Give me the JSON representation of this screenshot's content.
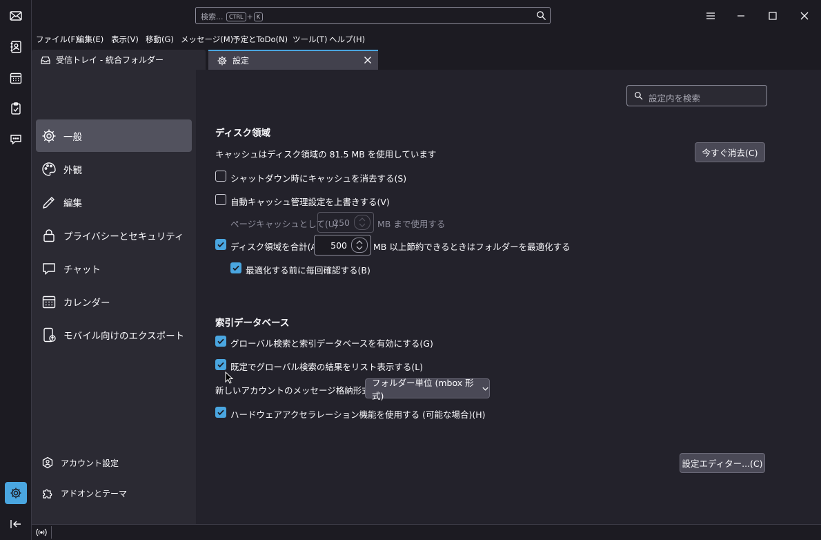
{
  "colors": {
    "accent": "#4aa6e0",
    "background": "#23222b",
    "nav": "#2b2a33",
    "selected": "#52525e"
  },
  "spaces": [
    {
      "icon": "mail-icon"
    },
    {
      "icon": "address-book-icon"
    },
    {
      "icon": "calendar-icon"
    },
    {
      "icon": "tasks-icon"
    },
    {
      "icon": "chat-icon"
    }
  ],
  "titlebar": {
    "search_placeholder": "検索...",
    "key_ctrl": "CTRL",
    "plus": "+",
    "key_k": "K"
  },
  "menubar": [
    "ファイル(F)",
    "編集(E)",
    "表示(V)",
    "移動(G)",
    "メッセージ(M)",
    "予定とToDo(N)",
    "ツール(T)",
    "ヘルプ(H)"
  ],
  "tabs": {
    "inbox": "受信トレイ - 統合フォルダー",
    "settings": "設定"
  },
  "nav": {
    "items": [
      "一般",
      "外観",
      "編集",
      "プライバシーとセキュリティ",
      "チャット",
      "カレンダー",
      "モバイル向けのエクスポート"
    ],
    "footer": [
      "アカウント設定",
      "アドオンとテーマ"
    ]
  },
  "pane": {
    "find_placeholder": "設定内を検索",
    "disk": {
      "heading": "ディスク領域",
      "cache_text": "キャッシュはディスク領域の 81.5 MB を使用しています",
      "clear_button": "今すぐ消去(C)",
      "clear_on_shutdown": "シャットダウン時にキャッシュを消去する(S)",
      "override_cache": "自動キャッシュ管理設定を上書きする(V)",
      "page_cache_label": "ページキャッシュとして(U)",
      "page_cache_value": "250",
      "page_cache_unit": "MB まで使用する",
      "compact_label": "ディスク領域を合計(A)",
      "compact_value": "500",
      "compact_unit": "MB 以上節約できるときはフォルダーを最適化する",
      "confirm_compact": "最適化する前に毎回確認する(B)"
    },
    "index": {
      "heading": "索引データベース",
      "global_search": "グローバル検索と索引データベースを有効にする(G)",
      "list_results": "既定でグローバル検索の結果をリスト表示する(L)",
      "store_label": "新しいアカウントのメッセージ格納形式:(T)",
      "store_value": "フォルダー単位 (mbox 形式)",
      "hw_accel": "ハードウェアアクセラレーション機能を使用する (可能な場合)(H)"
    },
    "config_editor": "設定エディター...(C)"
  }
}
